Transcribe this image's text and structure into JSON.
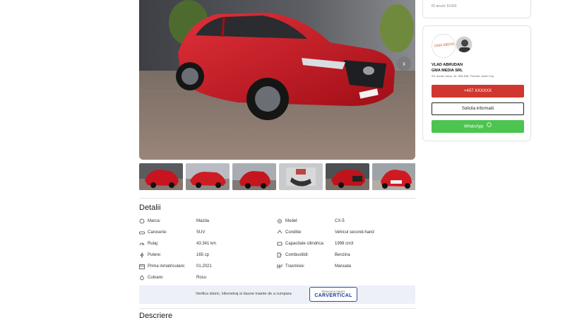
{
  "listing": {
    "ad_id_label": "ID anunt: 51416"
  },
  "gallery": {
    "next_icon": "chevron-right-icon",
    "thumbnail_count": 6
  },
  "details": {
    "title": "Detalii",
    "rows": [
      {
        "label": "Marca:",
        "value": "Mazda",
        "icon": "tag-icon"
      },
      {
        "label": "Model:",
        "value": "CX-5",
        "icon": "gear-icon"
      },
      {
        "label": "Caroserie:",
        "value": "SUV",
        "icon": "car-body-icon"
      },
      {
        "label": "Conditie:",
        "value": "Vehicul second-hand",
        "icon": "condition-icon"
      },
      {
        "label": "Rulaj:",
        "value": "43.341 km",
        "icon": "odometer-icon"
      },
      {
        "label": "Capacitate cilindrica:",
        "value": "1998 cm3",
        "icon": "engine-icon"
      },
      {
        "label": "Putere:",
        "value": "165 cp",
        "icon": "power-icon"
      },
      {
        "label": "Combustibil:",
        "value": "Benzina",
        "icon": "fuel-icon"
      },
      {
        "label": "Prima inmatriculare:",
        "value": "01.2021",
        "icon": "calendar-icon"
      },
      {
        "label": "Trasmisie:",
        "value": "Manuala",
        "icon": "transmission-icon"
      },
      {
        "label": "Culoare:",
        "value": "Rosu",
        "icon": "paint-icon"
      }
    ]
  },
  "carvertical": {
    "text": "Verifica istoric, kilometraj si daune inainte de a cumpara",
    "button_line1": "Descarca raport",
    "button_brand": "CARVERTICAL"
  },
  "description": {
    "title": "Descriere"
  },
  "seller": {
    "logo_text": "GMA MEDIA",
    "name": "VLAD ABRUDAN",
    "company": "GMA MEDIA SRL",
    "address": "Str. Avram Iancu, Nr. 506-508, Floresti, Judet Cluj",
    "phone_button": "+407 XXXXXX",
    "info_button": "Solicita informatii",
    "whatsapp_button": "WhatsApp",
    "whatsapp_icon": "whatsapp-icon"
  },
  "colors": {
    "phone_button": "#d0372e",
    "whatsapp_button": "#4cc44f",
    "carvertical_blue": "#1a3d9e",
    "car_red": "#c8141e"
  }
}
